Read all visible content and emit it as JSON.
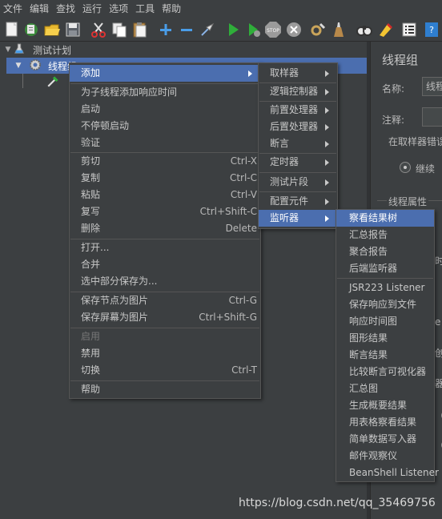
{
  "menubar": [
    "文件",
    "编辑",
    "查找",
    "运行",
    "选项",
    "工具",
    "帮助"
  ],
  "toolbar_icons": [
    "new-icon",
    "templates-icon",
    "open-icon",
    "save-icon",
    "cut-icon",
    "copy-icon",
    "paste-icon",
    "expand-icon",
    "collapse-icon",
    "toggle-icon",
    "start-icon",
    "start-no-pause-icon",
    "stop-icon",
    "shutdown-icon",
    "clear-icon",
    "clear-all-icon",
    "search-icon",
    "reset-search-icon",
    "function-helper-icon",
    "help-icon"
  ],
  "tree": {
    "test_plan": "测试计划",
    "thread_group": "线程组"
  },
  "right_panel": {
    "title": "线程组",
    "name_label": "名称:",
    "name_value": "线程",
    "comment_label": "注释:",
    "on_error": "在取样器错误",
    "continue_option": "继续",
    "thread_props": "线程属性"
  },
  "context_menu": {
    "items": [
      {
        "label": "添加",
        "submenu": true
      },
      {
        "label": "为子线程添加响应时间"
      },
      {
        "label": "启动"
      },
      {
        "label": "不停顿启动"
      },
      {
        "label": "验证"
      },
      {
        "label": "剪切",
        "shortcut": "Ctrl-X"
      },
      {
        "label": "复制",
        "shortcut": "Ctrl-C"
      },
      {
        "label": "粘贴",
        "shortcut": "Ctrl-V"
      },
      {
        "label": "复写",
        "shortcut": "Ctrl+Shift-C"
      },
      {
        "label": "删除",
        "shortcut": "Delete"
      },
      {
        "label": "打开..."
      },
      {
        "label": "合并"
      },
      {
        "label": "选中部分保存为..."
      },
      {
        "label": "保存节点为图片",
        "shortcut": "Ctrl-G"
      },
      {
        "label": "保存屏幕为图片",
        "shortcut": "Ctrl+Shift-G"
      },
      {
        "label": "启用",
        "disabled": true
      },
      {
        "label": "禁用"
      },
      {
        "label": "切换",
        "shortcut": "Ctrl-T"
      },
      {
        "label": "帮助"
      }
    ]
  },
  "add_menu": {
    "items": [
      "取样器",
      "逻辑控制器",
      "前置处理器",
      "后置处理器",
      "断言",
      "定时器",
      "测试片段",
      "配置元件",
      "监听器"
    ]
  },
  "listener_menu": {
    "items": [
      "察看结果树",
      "汇总报告",
      "聚合报告",
      "后端监听器",
      "JSR223 Listener",
      "保存响应到文件",
      "响应时间图",
      "图形结果",
      "断言结果",
      "比较断言可视化器",
      "汇总图",
      "生成概要结果",
      "用表格察看结果",
      "简单数据写入器",
      "邮件观察仪",
      "BeanShell Listener"
    ]
  },
  "watermark": "https://blog.csdn.net/qq_35469756",
  "colors": {
    "background": "#3c3f41",
    "highlight": "#4b6eaf",
    "text": "#c8c8c8"
  }
}
